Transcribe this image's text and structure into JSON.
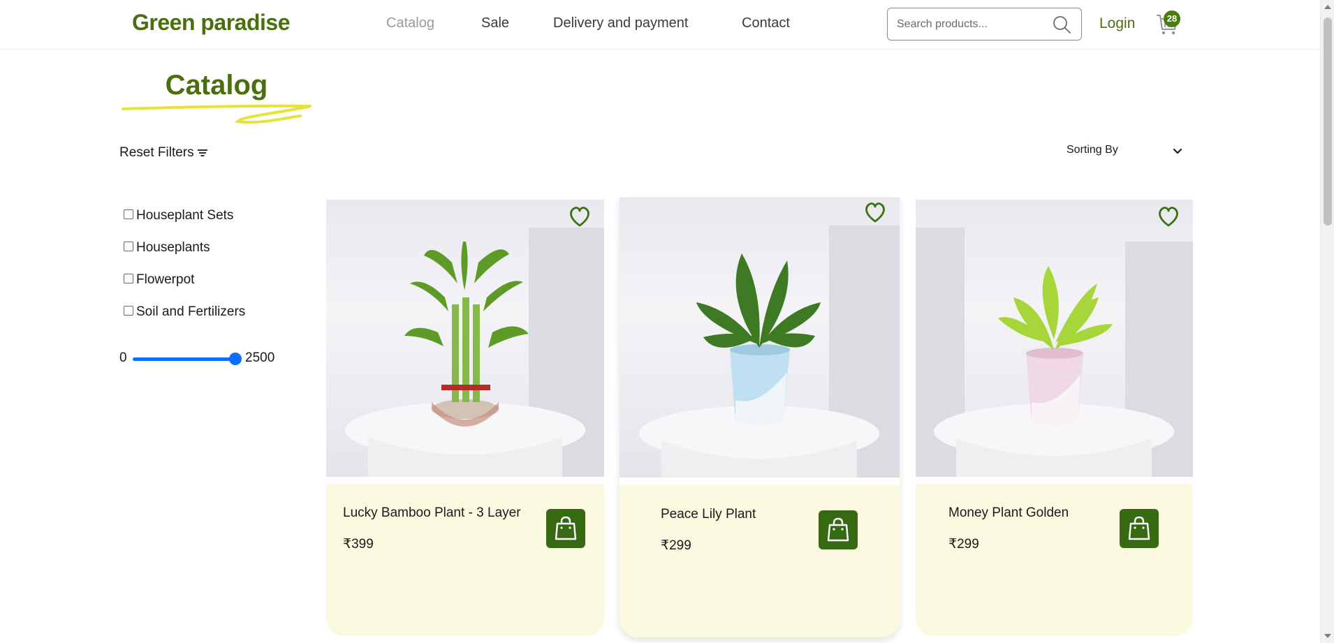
{
  "header": {
    "logo": "Green paradise",
    "nav": [
      {
        "label": "Catalog",
        "active": true
      },
      {
        "label": "Sale",
        "active": false
      },
      {
        "label": "Delivery and payment",
        "active": false
      },
      {
        "label": "Contact",
        "active": false
      }
    ],
    "search": {
      "placeholder": "Search products...",
      "value": "",
      "icon": "search-icon"
    },
    "login_label": "Login",
    "cart": {
      "icon": "cart-icon",
      "count": "28"
    }
  },
  "page": {
    "title": "Catalog",
    "reset_filters_label": "Reset Filters",
    "reset_icon": "filter-lines-icon",
    "sorting_label": "Sorting By",
    "sorting_icon": "chevron-down-icon"
  },
  "filters": {
    "categories": [
      {
        "label": "Houseplant Sets",
        "checked": false
      },
      {
        "label": "Houseplants",
        "checked": false
      },
      {
        "label": "Flowerpot",
        "checked": false
      },
      {
        "label": "Soil and Fertilizers",
        "checked": false
      }
    ],
    "price_range": {
      "min_label": "0",
      "max_label": "2500",
      "min": 0,
      "max": 2500,
      "value": 2500
    }
  },
  "products": [
    {
      "name": "Lucky Bamboo Plant - 3 Layer",
      "price": "₹399",
      "wishlist_icon": "heart-icon",
      "cart_icon": "shopping-bag-icon"
    },
    {
      "name": "Peace Lily Plant",
      "price": "₹299",
      "wishlist_icon": "heart-icon",
      "cart_icon": "shopping-bag-icon"
    },
    {
      "name": "Money Plant Golden",
      "price": "₹299",
      "wishlist_icon": "heart-icon",
      "cart_icon": "shopping-bag-icon"
    }
  ],
  "colors": {
    "brand_green": "#4a6f0e",
    "button_green": "#356a12",
    "card_bg": "#fbf9df",
    "highlight_yellow": "#e7e23a",
    "slider_blue": "#0d6efd"
  }
}
